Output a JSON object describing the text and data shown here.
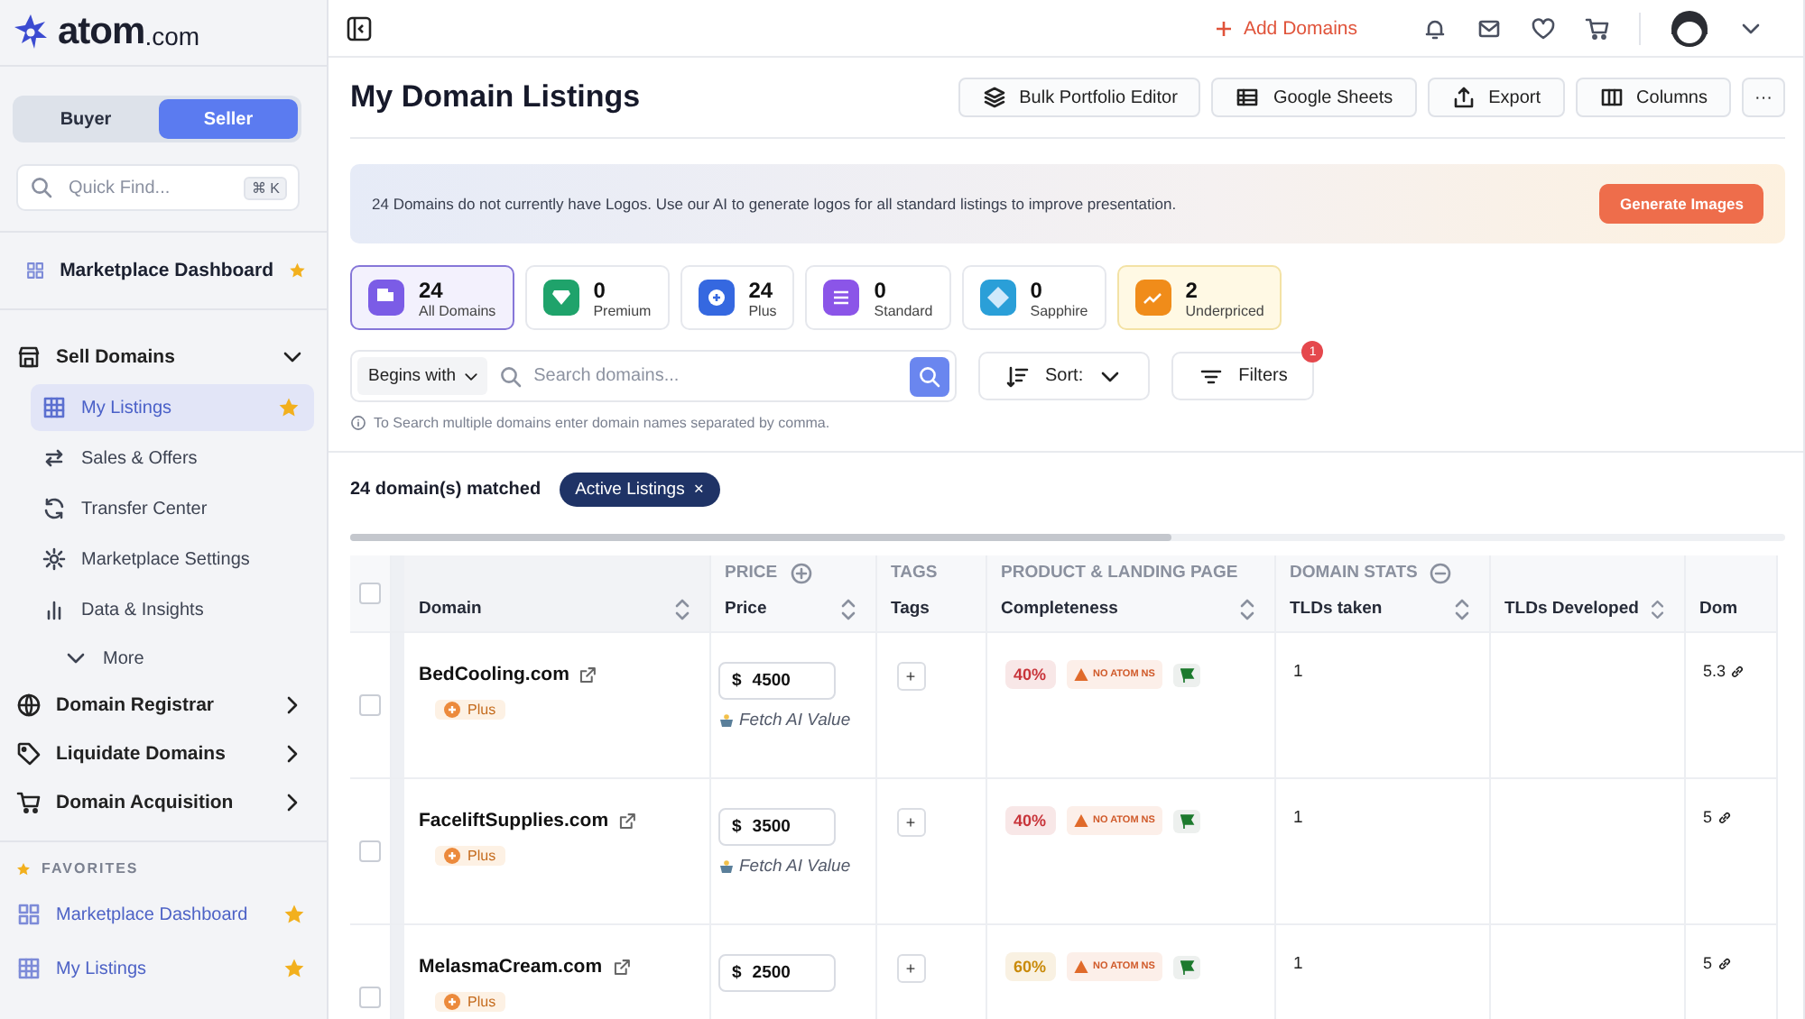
{
  "sidebar": {
    "logo": {
      "name": "atom",
      "suffix": ".com"
    },
    "mode_toggle": [
      {
        "label": "Buyer",
        "selected": false
      },
      {
        "label": "Seller",
        "selected": true
      }
    ],
    "quick_find": {
      "placeholder": "Quick Find...",
      "shortcut": "⌘ K"
    },
    "dashboard": {
      "label": "Marketplace Dashboard",
      "starred": true
    },
    "sections": [
      {
        "label": "Sell Domains",
        "expanded": true,
        "children": [
          {
            "label": "My Listings",
            "selected": true,
            "starred": true
          },
          {
            "label": "Sales & Offers",
            "selected": false,
            "starred": false
          },
          {
            "label": "Transfer Center",
            "selected": false,
            "starred": false
          },
          {
            "label": "Marketplace Settings",
            "selected": false,
            "starred": false
          },
          {
            "label": "Data & Insights",
            "selected": false,
            "starred": false
          }
        ],
        "more": "More"
      },
      {
        "label": "Domain Registrar",
        "expanded": false
      },
      {
        "label": "Liquidate Domains",
        "expanded": false
      },
      {
        "label": "Domain Acquisition",
        "expanded": false
      }
    ],
    "favorites": {
      "title": "FAVORITES",
      "items": [
        {
          "label": "Marketplace Dashboard",
          "starred": true
        },
        {
          "label": "My Listings",
          "starred": true
        }
      ]
    }
  },
  "topbar": {
    "add_domains": "Add Domains"
  },
  "page_title": "My Domain Listings",
  "toolbar": [
    "Bulk Portfolio Editor",
    "Google Sheets",
    "Export",
    "Columns",
    "···"
  ],
  "banner": {
    "text": "24 Domains do not currently have Logos. Use our AI to generate logos for all standard listings to improve presentation.",
    "button": "Generate Images"
  },
  "categories": [
    {
      "count": "24",
      "label": "All Domains",
      "color": "#7b5ce6",
      "selected": true,
      "highlighted": false
    },
    {
      "count": "0",
      "label": "Premium",
      "color": "#1fa36b",
      "selected": false,
      "highlighted": false
    },
    {
      "count": "24",
      "label": "Plus",
      "color": "#3568e0",
      "selected": false,
      "highlighted": false
    },
    {
      "count": "0",
      "label": "Standard",
      "color": "#8b55e8",
      "selected": false,
      "highlighted": false
    },
    {
      "count": "0",
      "label": "Sapphire",
      "color": "#2a9fd8",
      "selected": false,
      "highlighted": false
    },
    {
      "count": "2",
      "label": "Underpriced",
      "color": "#f08c1a",
      "selected": false,
      "highlighted": true
    }
  ],
  "search": {
    "match_mode": "Begins with",
    "placeholder": "Search domains...",
    "sort": "Sort:",
    "filters": "Filters",
    "filters_count": "1",
    "hint": "To Search multiple domains enter domain names separated by comma."
  },
  "results": {
    "matched": "24 domain(s) matched",
    "chip": "Active Listings",
    "chip_remove": "×"
  },
  "table": {
    "select_all": {
      "checked": false
    },
    "columns": [
      {
        "label": "Domain",
        "sortable": true
      },
      {
        "group": "PRICE",
        "label": "Price",
        "sortable": true
      },
      {
        "group": "TAGS",
        "label": "Tags",
        "sortable": false
      },
      {
        "group": "PRODUCT & LANDING PAGE",
        "label": "Completeness",
        "sortable": true
      },
      {
        "group": "DOMAIN STATS",
        "label": "TLDs taken",
        "sortable": true
      },
      {
        "label": "TLDs Developed",
        "sortable": true
      },
      {
        "label": "Dom",
        "sortable": false
      }
    ],
    "rows": [
      {
        "checked": false,
        "domain": "BedCooling.com",
        "tier": "Plus",
        "currency": "$",
        "price": "4500",
        "fetch": "Fetch AI Value",
        "tag_add": "+",
        "completeness": "40%",
        "color": "#c8343a",
        "ns": "NO ATOM NS",
        "tlds_taken": "1",
        "column_7": "5.3"
      },
      {
        "checked": false,
        "domain": "FaceliftSupplies.com",
        "tier": "Plus",
        "currency": "$",
        "price": "3500",
        "fetch": "Fetch AI Value",
        "tag_add": "+",
        "completeness": "40%",
        "color": "#c8343a",
        "ns": "NO ATOM NS",
        "tlds_taken": "1",
        "column_7": "5"
      },
      {
        "checked": false,
        "domain": "MelasmaCream.com",
        "tier": "Plus",
        "currency": "$",
        "price": "2500",
        "tag_add": "+",
        "completeness": "60%",
        "color": "#c98a0a",
        "ns": "NO ATOM NS",
        "tlds_taken": "1",
        "column_7": "5"
      }
    ]
  }
}
